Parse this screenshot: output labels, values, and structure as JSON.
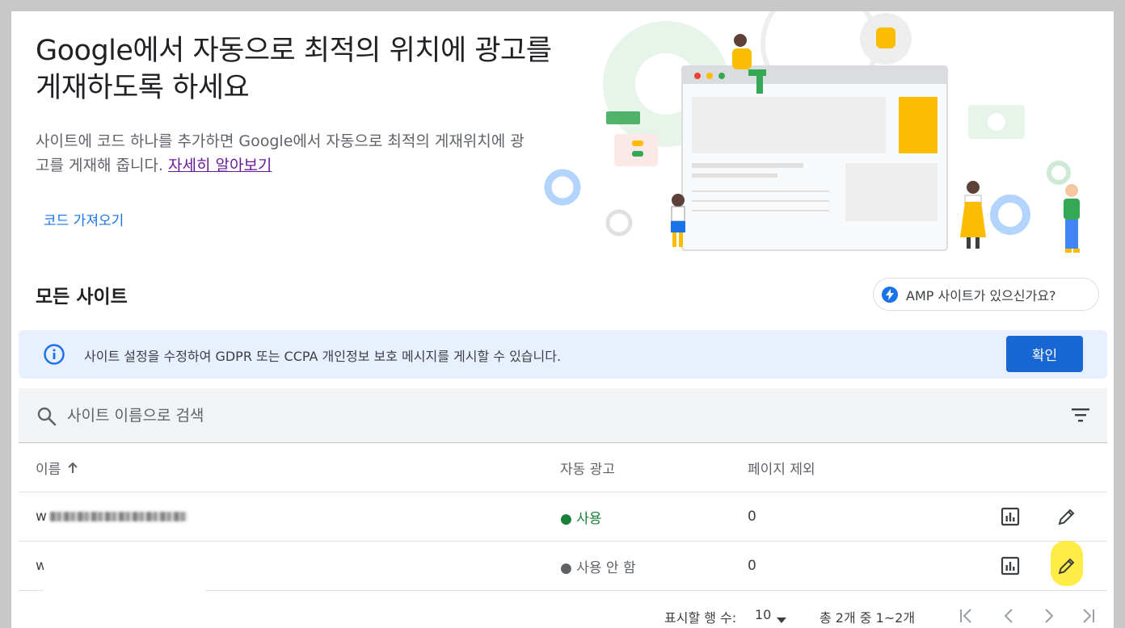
{
  "hero": {
    "title": "Google에서 자동으로 최적의 위치에 광고를 게재하도록 하세요",
    "description": "사이트에 코드 하나를 추가하면 Google에서 자동으로 최적의 게재위치에 광고를 게재해 줍니다.",
    "learn_more": "자세히 알아보기",
    "get_code": "코드 가져오기"
  },
  "sites": {
    "title": "모든 사이트",
    "amp_button": "AMP 사이트가 있으신가요?"
  },
  "banner": {
    "text": "사이트 설정을 수정하여 GDPR 또는 CCPA 개인정보 보호 메시지를 게시할 수 있습니다.",
    "confirm": "확인"
  },
  "search": {
    "placeholder": "사이트 이름으로 검색"
  },
  "table": {
    "columns": {
      "name": "이름",
      "auto_ads": "자동 광고",
      "excluded": "페이지 제외"
    },
    "rows": [
      {
        "name_prefix": "w",
        "status": "● 사용",
        "excluded": "0"
      },
      {
        "name_prefix": "w",
        "status": "● 사용 안 함",
        "excluded": "0"
      }
    ]
  },
  "pager": {
    "rows_label": "표시할 행 수:",
    "rows_value": "10",
    "range": "총 2개 중 1~2개"
  },
  "colors": {
    "primary": "#1967d2",
    "link": "#1a73e8",
    "status_on": "#188038",
    "banner_bg": "#e8f0fe"
  }
}
